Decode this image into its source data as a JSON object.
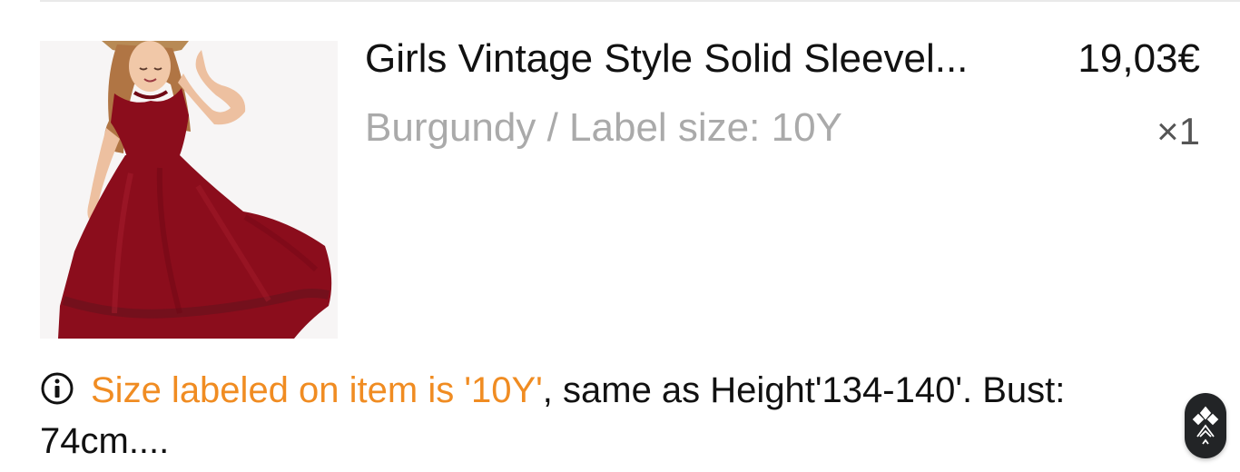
{
  "cart_item": {
    "image_alt": "Burgundy sleeveless maxi dress",
    "title": "Girls Vintage Style Solid Sleevel...",
    "price": "19,03€",
    "variant": "Burgundy / Label size: 10Y",
    "quantity": "×1"
  },
  "size_note": {
    "icon": "info-icon",
    "highlight": "Size labeled on item is '10Y'",
    "text": ", same as Height'134-140'. Bust: 74cm...."
  },
  "floating_badge": {
    "icon": "brand-logo-icon"
  },
  "colors": {
    "accent": "#f08c22",
    "muted": "#aaaaaa",
    "dress": "#8b0d1c",
    "badge_bg": "#222426"
  }
}
